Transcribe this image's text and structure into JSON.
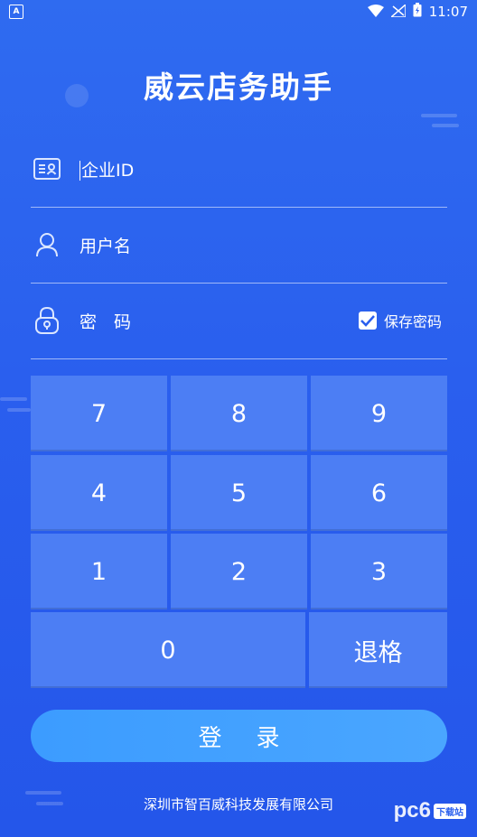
{
  "status_bar": {
    "app_icon_letter": "A",
    "time": "11:07"
  },
  "app": {
    "title": "威云店务助手"
  },
  "login_form": {
    "enterprise_id_placeholder": "企业ID",
    "username_placeholder": "用户名",
    "password_placeholder": "密　码",
    "save_password_label": "保存密码",
    "save_password_checked": true
  },
  "keypad": {
    "keys": [
      "7",
      "8",
      "9",
      "4",
      "5",
      "6",
      "1",
      "2",
      "3"
    ],
    "zero": "0",
    "backspace": "退格"
  },
  "login_button": "登录",
  "footer": {
    "company": "深圳市智百威科技发展有限公司"
  },
  "watermark": {
    "text": "pc6",
    "badge": "下载站"
  },
  "colors": {
    "background": "#2a5fee",
    "key": "#4c7ef4",
    "button": "#3c9cff"
  }
}
